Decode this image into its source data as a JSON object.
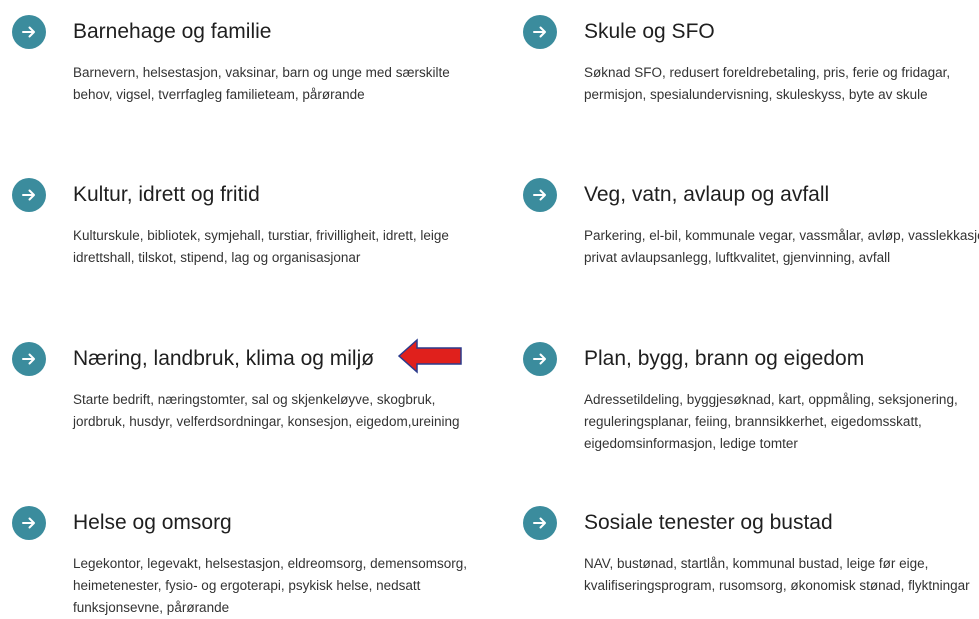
{
  "accent_color": "#3b8c9d",
  "pointer_color": "#e0201c",
  "cards": [
    {
      "title": "Barnehage og familie",
      "description": "Barnevern, helsestasjon, vaksinar, barn og unge med særskilte behov, vigsel, tverrfagleg familieteam, pårørande",
      "icon": "arrow-right-icon"
    },
    {
      "title": "Skule og SFO",
      "description": "Søknad SFO, redusert foreldrebetaling, pris, ferie og fridagar, permisjon, spesialundervisning, skuleskyss, byte av skule",
      "icon": "arrow-right-icon"
    },
    {
      "title": "Kultur, idrett og fritid",
      "description": "Kulturskule, bibliotek, symjehall, turstiar, frivilligheit, idrett, leige idrettshall, tilskot, stipend, lag og organisasjonar",
      "icon": "arrow-right-icon"
    },
    {
      "title": "Veg, vatn, avlaup og avfall",
      "description": "Parkering, el-bil, kommunale vegar, vassmålar, avløp, vasslekkasje, privat avlaupsanlegg, luftkvalitet, gjenvinning, avfall",
      "icon": "arrow-right-icon"
    },
    {
      "title": "Næring, landbruk, klima og miljø",
      "description": "Starte bedrift, næringstomter, sal og skjenkeløyve, skogbruk, jordbruk, husdyr, velferdsordningar, konsesjon, eigedom,ureining",
      "icon": "arrow-right-icon"
    },
    {
      "title": "Plan, bygg, brann og eigedom",
      "description": "Adressetildeling, byggjesøknad, kart, oppmåling, seksjonering, reguleringsplanar, feiing, brannsikkerhet, eigedomsskatt, eigedomsinformasjon, ledige tomter",
      "icon": "arrow-right-icon"
    },
    {
      "title": "Helse og omsorg",
      "description": "Legekontor, legevakt, helsestasjon, eldreomsorg, demensomsorg, heimetenester, fysio- og ergoterapi, psykisk helse, nedsatt funksjonsevne, pårørande",
      "icon": "arrow-right-icon"
    },
    {
      "title": "Sosiale tenester og bustad",
      "description": "NAV, bustønad, startlån, kommunal bustad, leige før eige, kvalifiseringsprogram, rusomsorg, økonomisk stønad, flyktningar",
      "icon": "arrow-right-icon"
    }
  ]
}
